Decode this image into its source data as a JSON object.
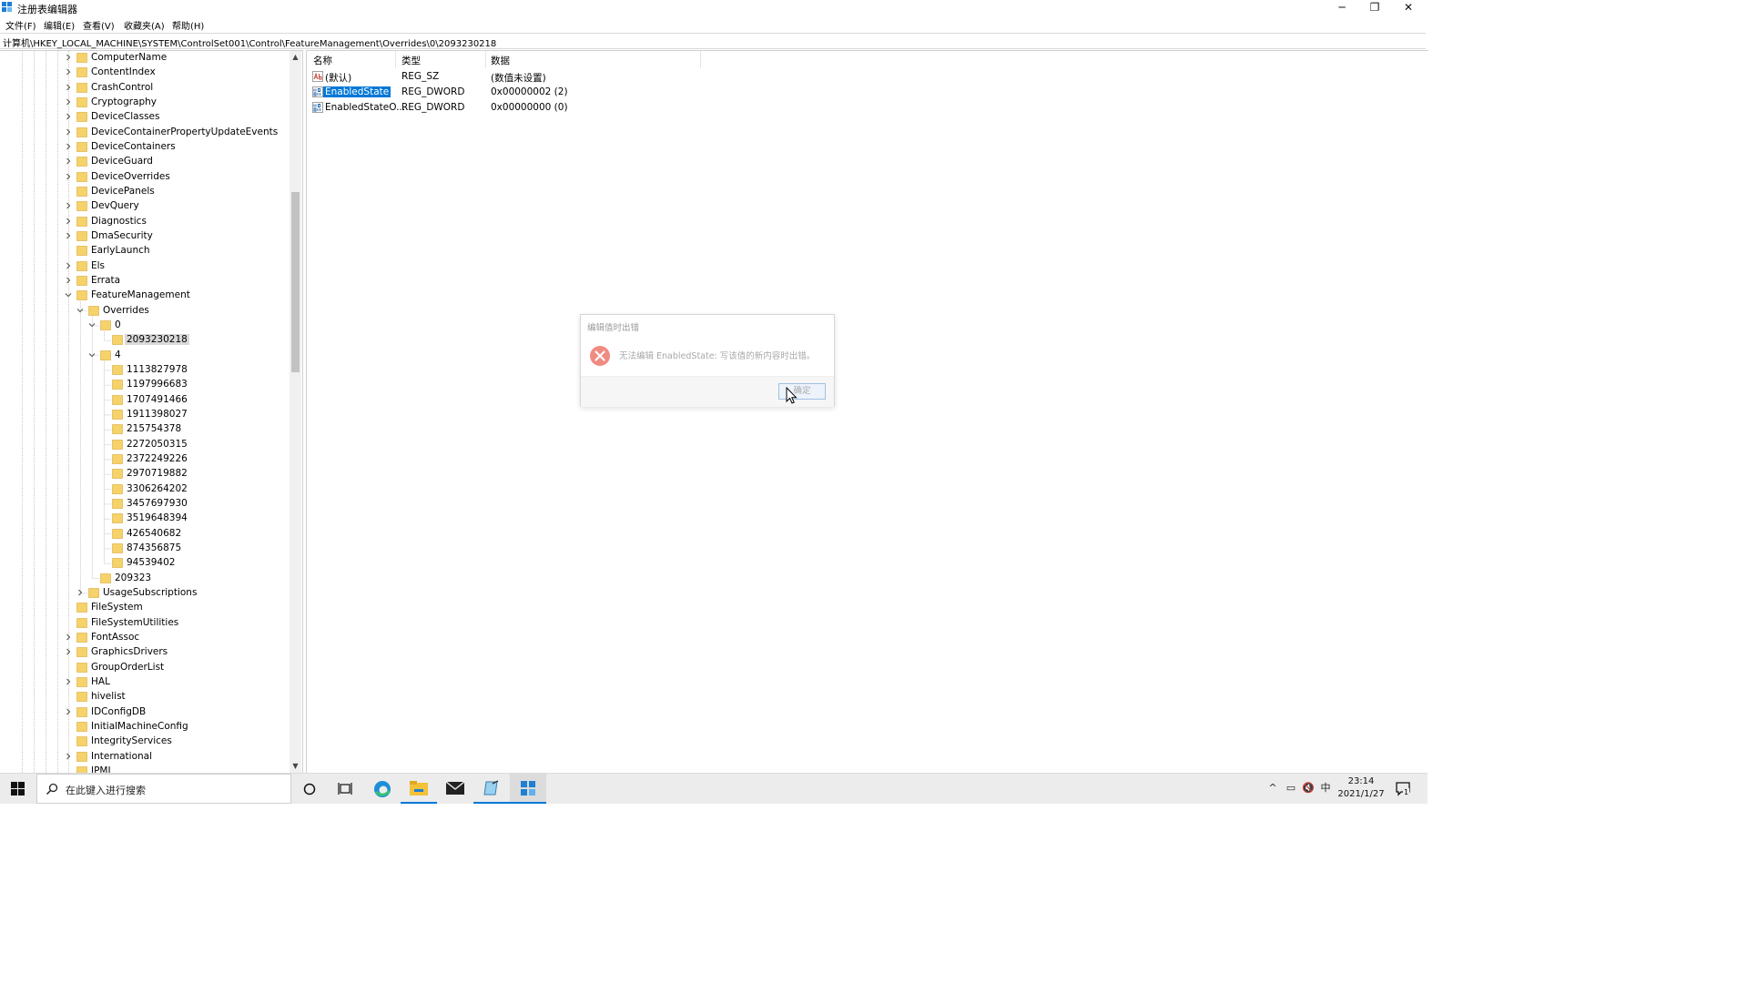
{
  "window": {
    "title": "注册表编辑器",
    "minimize_glyph": "─",
    "maximize_glyph": "❐",
    "close_glyph": "✕"
  },
  "menu": [
    "文件(F)",
    "编辑(E)",
    "查看(V)",
    "收藏夹(A)",
    "帮助(H)"
  ],
  "address": "计算机\\HKEY_LOCAL_MACHINE\\SYSTEM\\ControlSet001\\Control\\FeatureManagement\\Overrides\\0\\2093230218",
  "tree": {
    "scroll_up": "▲",
    "scroll_down": "▼",
    "nodes": [
      {
        "label": "ComputerName",
        "level": 0,
        "expander": "collapsed"
      },
      {
        "label": "ContentIndex",
        "level": 0,
        "expander": "collapsed"
      },
      {
        "label": "CrashControl",
        "level": 0,
        "expander": "collapsed"
      },
      {
        "label": "Cryptography",
        "level": 0,
        "expander": "collapsed"
      },
      {
        "label": "DeviceClasses",
        "level": 0,
        "expander": "collapsed"
      },
      {
        "label": "DeviceContainerPropertyUpdateEvents",
        "level": 0,
        "expander": "collapsed"
      },
      {
        "label": "DeviceContainers",
        "level": 0,
        "expander": "collapsed"
      },
      {
        "label": "DeviceGuard",
        "level": 0,
        "expander": "collapsed"
      },
      {
        "label": "DeviceOverrides",
        "level": 0,
        "expander": "collapsed"
      },
      {
        "label": "DevicePanels",
        "level": 0,
        "expander": "none"
      },
      {
        "label": "DevQuery",
        "level": 0,
        "expander": "collapsed"
      },
      {
        "label": "Diagnostics",
        "level": 0,
        "expander": "collapsed"
      },
      {
        "label": "DmaSecurity",
        "level": 0,
        "expander": "collapsed"
      },
      {
        "label": "EarlyLaunch",
        "level": 0,
        "expander": "none"
      },
      {
        "label": "Els",
        "level": 0,
        "expander": "collapsed"
      },
      {
        "label": "Errata",
        "level": 0,
        "expander": "collapsed"
      },
      {
        "label": "FeatureManagement",
        "level": 0,
        "expander": "expanded"
      },
      {
        "label": "Overrides",
        "level": 1,
        "expander": "expanded"
      },
      {
        "label": "0",
        "level": 2,
        "expander": "expanded"
      },
      {
        "label": "2093230218",
        "level": 3,
        "expander": "none",
        "selected": true
      },
      {
        "label": "4",
        "level": 2,
        "expander": "expanded"
      },
      {
        "label": "1113827978",
        "level": 3,
        "expander": "none"
      },
      {
        "label": "1197996683",
        "level": 3,
        "expander": "none"
      },
      {
        "label": "1707491466",
        "level": 3,
        "expander": "none"
      },
      {
        "label": "1911398027",
        "level": 3,
        "expander": "none"
      },
      {
        "label": "215754378",
        "level": 3,
        "expander": "none"
      },
      {
        "label": "2272050315",
        "level": 3,
        "expander": "none"
      },
      {
        "label": "2372249226",
        "level": 3,
        "expander": "none"
      },
      {
        "label": "2970719882",
        "level": 3,
        "expander": "none"
      },
      {
        "label": "3306264202",
        "level": 3,
        "expander": "none"
      },
      {
        "label": "3457697930",
        "level": 3,
        "expander": "none"
      },
      {
        "label": "3519648394",
        "level": 3,
        "expander": "none"
      },
      {
        "label": "426540682",
        "level": 3,
        "expander": "none"
      },
      {
        "label": "874356875",
        "level": 3,
        "expander": "none"
      },
      {
        "label": "94539402",
        "level": 3,
        "expander": "none"
      },
      {
        "label": "209323",
        "level": 2,
        "expander": "none"
      },
      {
        "label": "UsageSubscriptions",
        "level": 1,
        "expander": "collapsed"
      },
      {
        "label": "FileSystem",
        "level": 0,
        "expander": "none"
      },
      {
        "label": "FileSystemUtilities",
        "level": 0,
        "expander": "none"
      },
      {
        "label": "FontAssoc",
        "level": 0,
        "expander": "collapsed"
      },
      {
        "label": "GraphicsDrivers",
        "level": 0,
        "expander": "collapsed"
      },
      {
        "label": "GroupOrderList",
        "level": 0,
        "expander": "none"
      },
      {
        "label": "HAL",
        "level": 0,
        "expander": "collapsed"
      },
      {
        "label": "hivelist",
        "level": 0,
        "expander": "none"
      },
      {
        "label": "IDConfigDB",
        "level": 0,
        "expander": "collapsed"
      },
      {
        "label": "InitialMachineConfig",
        "level": 0,
        "expander": "none"
      },
      {
        "label": "IntegrityServices",
        "level": 0,
        "expander": "none"
      },
      {
        "label": "International",
        "level": 0,
        "expander": "collapsed"
      },
      {
        "label": "IPMI",
        "level": 0,
        "expander": "none"
      }
    ]
  },
  "list": {
    "headers": {
      "name": "名称",
      "type": "类型",
      "data": "数据"
    },
    "rows": [
      {
        "icon": "string-value-icon",
        "name": "(默认)",
        "type": "REG_SZ",
        "data": "(数值未设置)",
        "selected": false
      },
      {
        "icon": "binary-value-icon",
        "name": "EnabledState",
        "type": "REG_DWORD",
        "data": "0x00000002 (2)",
        "selected": true
      },
      {
        "icon": "binary-value-icon",
        "name": "EnabledStateO...",
        "type": "REG_DWORD",
        "data": "0x00000000 (0)",
        "selected": false
      }
    ]
  },
  "dialog": {
    "title": "编辑值时出错",
    "message": "无法编辑 EnabledState: 写该值的新内容时出错。",
    "ok_label": "确定"
  },
  "taskbar": {
    "search_placeholder": "在此键入进行搜索",
    "tray": {
      "chevron": "^",
      "network": "▭",
      "volume": "🔇",
      "ime": "中"
    },
    "time": "23:14",
    "date": "2021/1/27",
    "notification_count": "1"
  },
  "colors": {
    "selection": "#0078d7",
    "folder": "#f6d26b",
    "error": "#e84a3c"
  }
}
